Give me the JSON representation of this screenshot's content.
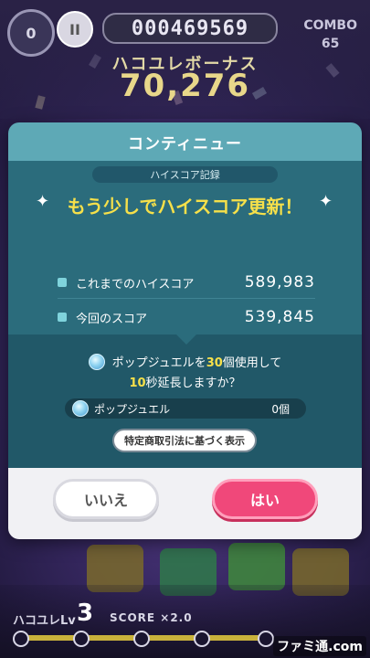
{
  "hud": {
    "combo_circle": "0",
    "pause_symbol": "II",
    "score": "000469569",
    "combo_label": "COMBO",
    "combo_value": "65",
    "bonus_label": "ハコユレボーナス",
    "bonus_value": "70,276",
    "level_label": "ハコユレLv",
    "level_value": "3",
    "score_multiplier": "SCORE ×2.0",
    "watermark": "ファミ通.com"
  },
  "dialog": {
    "title": "コンティニュー",
    "record_label": "ハイスコア記録",
    "headline": "もう少しでハイスコア更新！",
    "rows": [
      {
        "label": "これまでのハイスコア",
        "value": "589,983"
      },
      {
        "label": "今回のスコア",
        "value": "539,845"
      }
    ],
    "ask_pre": "ポップジュエルを",
    "ask_count": "30",
    "ask_mid": "個使用して",
    "ask_seconds": "10",
    "ask_post": "秒延長しますか？",
    "gem_label": "ポップジュエル",
    "gem_count": "0個",
    "legal_button": "特定商取引法に基づく表示",
    "no_button": "いいえ",
    "yes_button": "はい"
  },
  "colors": {
    "header": "#5ea9b6",
    "panel": "#2b6c7c",
    "highlight": "#f6e04a",
    "yes_button": "#f0487a"
  }
}
